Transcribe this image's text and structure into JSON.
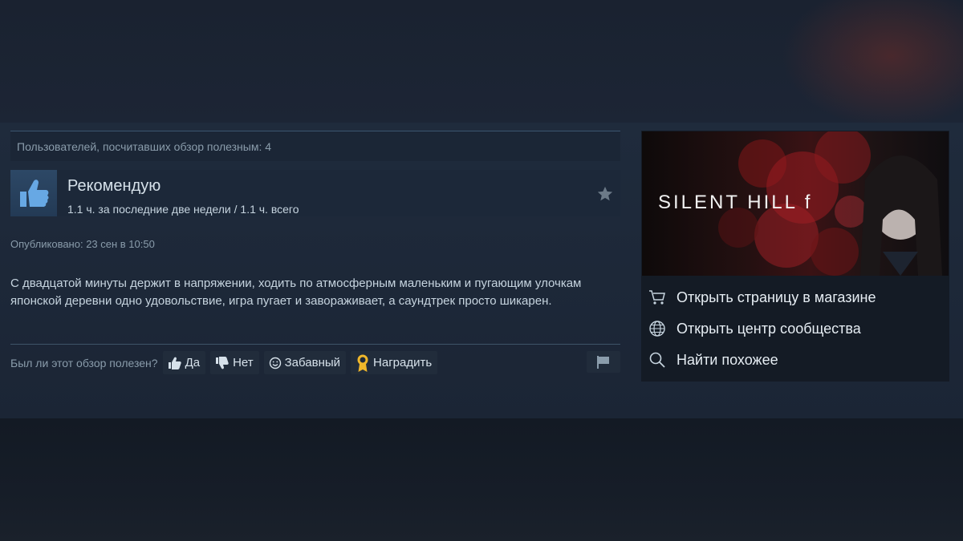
{
  "review": {
    "helpful_count_text": "Пользователей, посчитавших обзор полезным: 4",
    "recommendation": "Рекомендую",
    "hours": "1.1 ч. за последние две недели / 1.1 ч. всего",
    "posted": "Опубликовано: 23 сен в 10:50",
    "text": "С двадцатой минуты держит в напряжении, ходить по атмосферным маленьким и пугающим улочкам японской деревни одно удовольствие, игра пугает и завораживает, а саундтрек просто шикарен.",
    "vote_question": "Был ли этот обзор полезен?",
    "buttons": {
      "yes": "Да",
      "no": "Нет",
      "funny": "Забавный",
      "award": "Наградить"
    }
  },
  "sidebar": {
    "game_title": "SILENT HILL f",
    "links": [
      {
        "label": "Открыть страницу в магазине",
        "icon": "cart-icon"
      },
      {
        "label": "Открыть центр сообщества",
        "icon": "globe-icon"
      },
      {
        "label": "Найти похожее",
        "icon": "search-icon"
      }
    ]
  },
  "colors": {
    "background": "#1b2535",
    "panel": "#1c2839",
    "accent_thumb": "#67a8e4",
    "text": "#c6d4df",
    "muted": "#8a9cab",
    "award_gold": "#f0b72a"
  }
}
